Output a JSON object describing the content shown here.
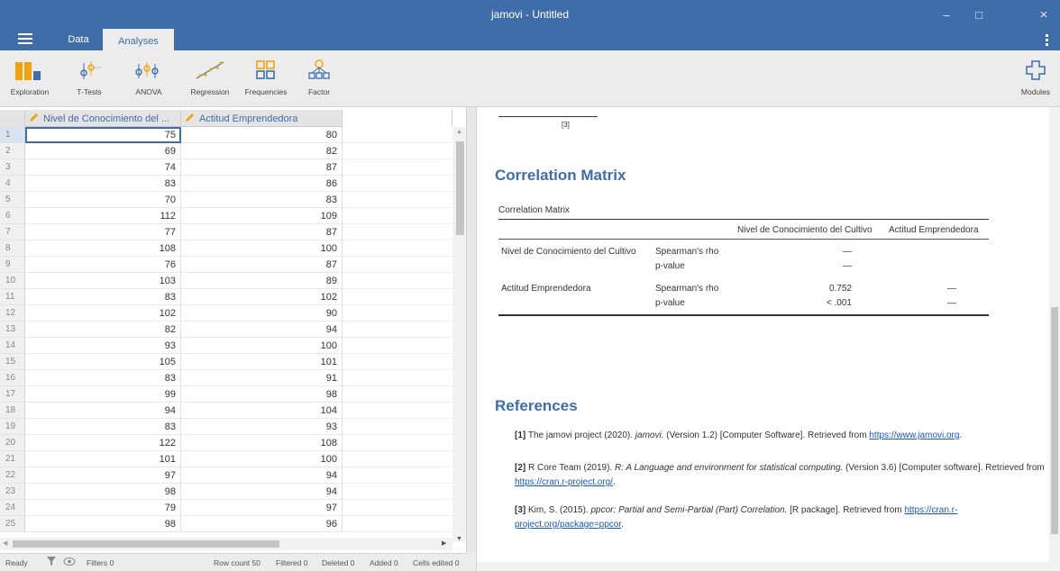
{
  "window": {
    "title": "jamovi - Untitled"
  },
  "tabs": [
    {
      "label": "Data",
      "active": false
    },
    {
      "label": "Analyses",
      "active": true
    }
  ],
  "ribbon": {
    "buttons": [
      {
        "label": "Exploration",
        "icon": "exploration-icon"
      },
      {
        "label": "T-Tests",
        "icon": "ttests-icon"
      },
      {
        "label": "ANOVA",
        "icon": "anova-icon"
      },
      {
        "label": "Regression",
        "icon": "regression-icon"
      },
      {
        "label": "Frequencies",
        "icon": "frequencies-icon"
      },
      {
        "label": "Factor",
        "icon": "factor-icon"
      }
    ],
    "modules_label": "Modules"
  },
  "sheet": {
    "columns": [
      "Nivel de Conocimiento del ...",
      "Actitud Emprendedora"
    ],
    "rows": [
      {
        "n": "1",
        "a": "75",
        "b": "80"
      },
      {
        "n": "2",
        "a": "69",
        "b": "82"
      },
      {
        "n": "3",
        "a": "74",
        "b": "87"
      },
      {
        "n": "4",
        "a": "83",
        "b": "86"
      },
      {
        "n": "5",
        "a": "70",
        "b": "83"
      },
      {
        "n": "6",
        "a": "112",
        "b": "109"
      },
      {
        "n": "7",
        "a": "77",
        "b": "87"
      },
      {
        "n": "8",
        "a": "108",
        "b": "100"
      },
      {
        "n": "9",
        "a": "76",
        "b": "87"
      },
      {
        "n": "10",
        "a": "103",
        "b": "89"
      },
      {
        "n": "11",
        "a": "83",
        "b": "102"
      },
      {
        "n": "12",
        "a": "102",
        "b": "90"
      },
      {
        "n": "13",
        "a": "82",
        "b": "94"
      },
      {
        "n": "14",
        "a": "93",
        "b": "100"
      },
      {
        "n": "15",
        "a": "105",
        "b": "101"
      },
      {
        "n": "16",
        "a": "83",
        "b": "91"
      },
      {
        "n": "17",
        "a": "99",
        "b": "98"
      },
      {
        "n": "18",
        "a": "94",
        "b": "104"
      },
      {
        "n": "19",
        "a": "83",
        "b": "93"
      },
      {
        "n": "20",
        "a": "122",
        "b": "108"
      },
      {
        "n": "21",
        "a": "101",
        "b": "100"
      },
      {
        "n": "22",
        "a": "97",
        "b": "94"
      },
      {
        "n": "23",
        "a": "98",
        "b": "94"
      },
      {
        "n": "24",
        "a": "79",
        "b": "97"
      },
      {
        "n": "25",
        "a": "98",
        "b": "96"
      }
    ]
  },
  "status": {
    "ready": "Ready",
    "filters": "Filters 0",
    "row_count": "Row count 50",
    "filtered": "Filtered 0",
    "deleted": "Deleted 0",
    "added": "Added 0",
    "cells_edited": "Cells edited 0"
  },
  "results": {
    "footnote": "[3]",
    "heading": "Correlation Matrix",
    "table": {
      "title": "Correlation Matrix",
      "col1": "Nivel de Conocimiento del Cultivo",
      "col2": "Actitud Emprendedora",
      "rows": [
        {
          "var": "Nivel de Conocimiento del Cultivo",
          "stat": "Spearman's rho",
          "v1": "—",
          "v2": ""
        },
        {
          "var": "",
          "stat": "p-value",
          "v1": "—",
          "v2": ""
        },
        {
          "var": "Actitud Emprendedora",
          "stat": "Spearman's rho",
          "v1": "0.752",
          "v2": "—"
        },
        {
          "var": "",
          "stat": "p-value",
          "v1": "< .001",
          "v2": "—"
        }
      ]
    },
    "references_heading": "References",
    "refs": [
      {
        "num": "[1]",
        "pre": "The jamovi project (2020).",
        "title": "jamovi.",
        "post": "(Version 1.2) [Computer Software]. Retrieved from",
        "link": "https://www.jamovi.org",
        "end": "."
      },
      {
        "num": "[2]",
        "pre": "R Core Team (2019).",
        "title": "R: A Language and environment for statistical computing.",
        "post": "(Version 3.6) [Computer software]. Retrieved from",
        "link": "https://cran.r-project.org/",
        "end": "."
      },
      {
        "num": "[3]",
        "pre": "Kim, S. (2015).",
        "title": "ppcor: Partial and Semi-Partial (Part) Correlation.",
        "post": "[R package]. Retrieved from",
        "link": "https://cran.r-project.org/package=ppcor",
        "end": "."
      }
    ]
  },
  "colors": {
    "brand": "#3e6da9",
    "link": "#1a55c4"
  }
}
